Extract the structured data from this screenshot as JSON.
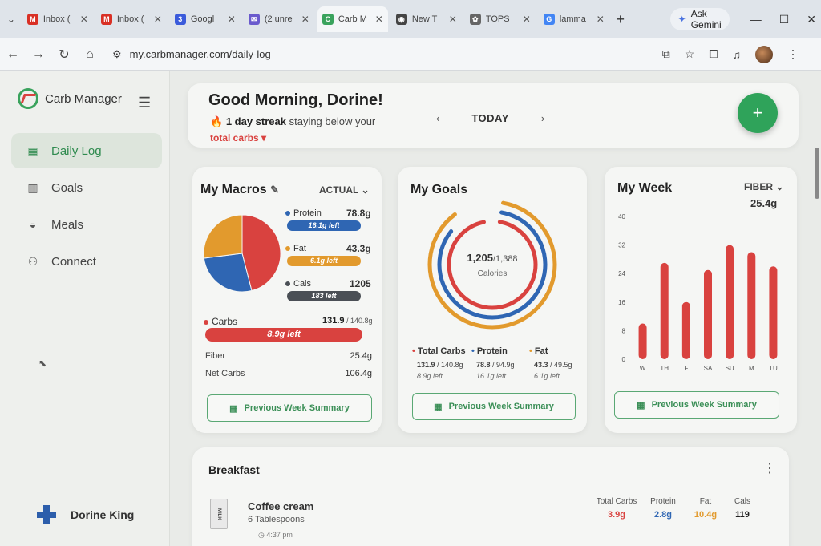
{
  "browser": {
    "tabs": [
      {
        "label": "Inbox (",
        "fav": "M",
        "color": "#d93025"
      },
      {
        "label": "Inbox (",
        "fav": "M",
        "color": "#d93025"
      },
      {
        "label": "Googl",
        "fav": "3",
        "color": "#3b5bdb"
      },
      {
        "label": "(2 unre",
        "fav": "✉",
        "color": "#6a5acd"
      },
      {
        "label": "Carb M",
        "fav": "C",
        "color": "#3aa35d"
      },
      {
        "label": "New T",
        "fav": "◉",
        "color": "#444444"
      },
      {
        "label": "TOPS",
        "fav": "✿",
        "color": "#666666"
      },
      {
        "label": "lamma",
        "fav": "G",
        "color": "#4285f4"
      }
    ],
    "gemini_label": "Ask Gemini",
    "url": "my.carbmanager.com/daily-log"
  },
  "sidebar": {
    "brand": "Carb Manager",
    "items": [
      {
        "label": "Daily Log",
        "icon": "grid-icon"
      },
      {
        "label": "Goals",
        "icon": "bar-chart-icon"
      },
      {
        "label": "Meals",
        "icon": "bowl-icon"
      },
      {
        "label": "Connect",
        "icon": "people-icon"
      }
    ],
    "user_name": "Dorine King"
  },
  "header": {
    "greeting": "Good Morning, Dorine!",
    "streak_bold": "1 day streak",
    "streak_rest": " staying below your",
    "carbs_link": "total carbs",
    "day_label": "TODAY"
  },
  "macros": {
    "title": "My Macros",
    "mode": "ACTUAL",
    "protein": {
      "label": "Protein",
      "value": "78.8g",
      "left": "16.1g left",
      "color": "#2f66b3"
    },
    "fat": {
      "label": "Fat",
      "value": "43.3g",
      "left": "6.1g left",
      "color": "#e29a2d"
    },
    "cals": {
      "label": "Cals",
      "value": "1205",
      "left": "183 left",
      "color": "#4a4f55"
    },
    "carbs": {
      "label": "Carbs",
      "value": "131.9",
      "target": " / 140.8g",
      "left": "8.9g left",
      "color": "#d9423f"
    },
    "fiber_label": "Fiber",
    "fiber_value": "25.4g",
    "netcarbs_label": "Net Carbs",
    "netcarbs_value": "106.4g",
    "button": "Previous Week Summary",
    "pie": [
      {
        "name": "Carbs",
        "value": 46,
        "color": "#d9423f"
      },
      {
        "name": "Protein",
        "value": 27,
        "color": "#2f66b3"
      },
      {
        "name": "Fat",
        "value": 27,
        "color": "#e29a2d"
      }
    ]
  },
  "goals": {
    "title": "My Goals",
    "center_value": "1,205",
    "center_target": "/1,388",
    "center_label": "Calories",
    "rings": [
      {
        "name": "Fat",
        "fraction": 0.87,
        "color": "#e29a2d"
      },
      {
        "name": "Protein",
        "fraction": 0.83,
        "color": "#2f66b3"
      },
      {
        "name": "Total Carbs",
        "fraction": 0.94,
        "color": "#d9423f"
      }
    ],
    "legend": [
      {
        "label": "Total Carbs",
        "value": "131.9",
        "target": " / 140.8g",
        "left": "8.9g left",
        "color": "#d9423f"
      },
      {
        "label": "Protein",
        "value": "78.8",
        "target": " / 94.9g",
        "left": "16.1g left",
        "color": "#2f66b3"
      },
      {
        "label": "Fat",
        "value": "43.3",
        "target": " / 49.5g",
        "left": "6.1g left",
        "color": "#e29a2d"
      }
    ],
    "button": "Previous Week Summary"
  },
  "week": {
    "title": "My Week",
    "metric": "FIBER",
    "value": "25.4g",
    "button": "Previous Week Summary",
    "chart_data": {
      "type": "bar",
      "categories": [
        "W",
        "TH",
        "F",
        "SA",
        "SU",
        "M",
        "TU"
      ],
      "values": [
        10,
        27,
        16,
        25,
        32,
        30,
        26
      ],
      "ylim": [
        0,
        40
      ],
      "yticks": [
        "40",
        "32",
        "24",
        "16",
        "8",
        "0"
      ],
      "color": "#d9423f"
    }
  },
  "breakfast": {
    "title": "Breakfast",
    "item_name": "Coffee cream",
    "item_qty": "6 Tablespoons",
    "item_time": "4:37 pm",
    "headers": [
      "Total Carbs",
      "Protein",
      "Fat",
      "Cals"
    ],
    "values": [
      "3.9g",
      "2.8g",
      "10.4g",
      "119"
    ],
    "value_colors": [
      "#d9423f",
      "#2f66b3",
      "#e29a2d",
      "#222222"
    ],
    "milk_label": "MILK"
  }
}
